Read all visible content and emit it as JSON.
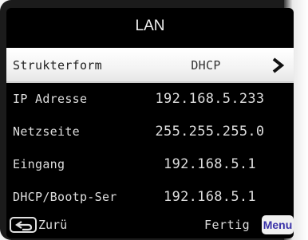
{
  "screen": {
    "title": "LAN"
  },
  "rows": [
    {
      "label": "Strukterform",
      "value": "DHCP"
    },
    {
      "label": "IP Adresse",
      "value": "192.168.5.233"
    },
    {
      "label": "Netzseite",
      "value": "255.255.255.0"
    },
    {
      "label": "Eingang",
      "value": "192.168.5.1"
    },
    {
      "label": "DHCP/Bootp-Ser",
      "value": "192.168.5.1"
    }
  ],
  "footer": {
    "back_label": "Zurü",
    "done_label": "Fertig",
    "menu_label": "Menu"
  },
  "icons": {
    "selected_row": "chevron-right-icon",
    "back": "return-arrow-icon"
  },
  "colors": {
    "screen_bg": "#000000",
    "text": "#dedede",
    "highlight_bg": "#ffffff",
    "menu_text": "#3a32a8"
  }
}
